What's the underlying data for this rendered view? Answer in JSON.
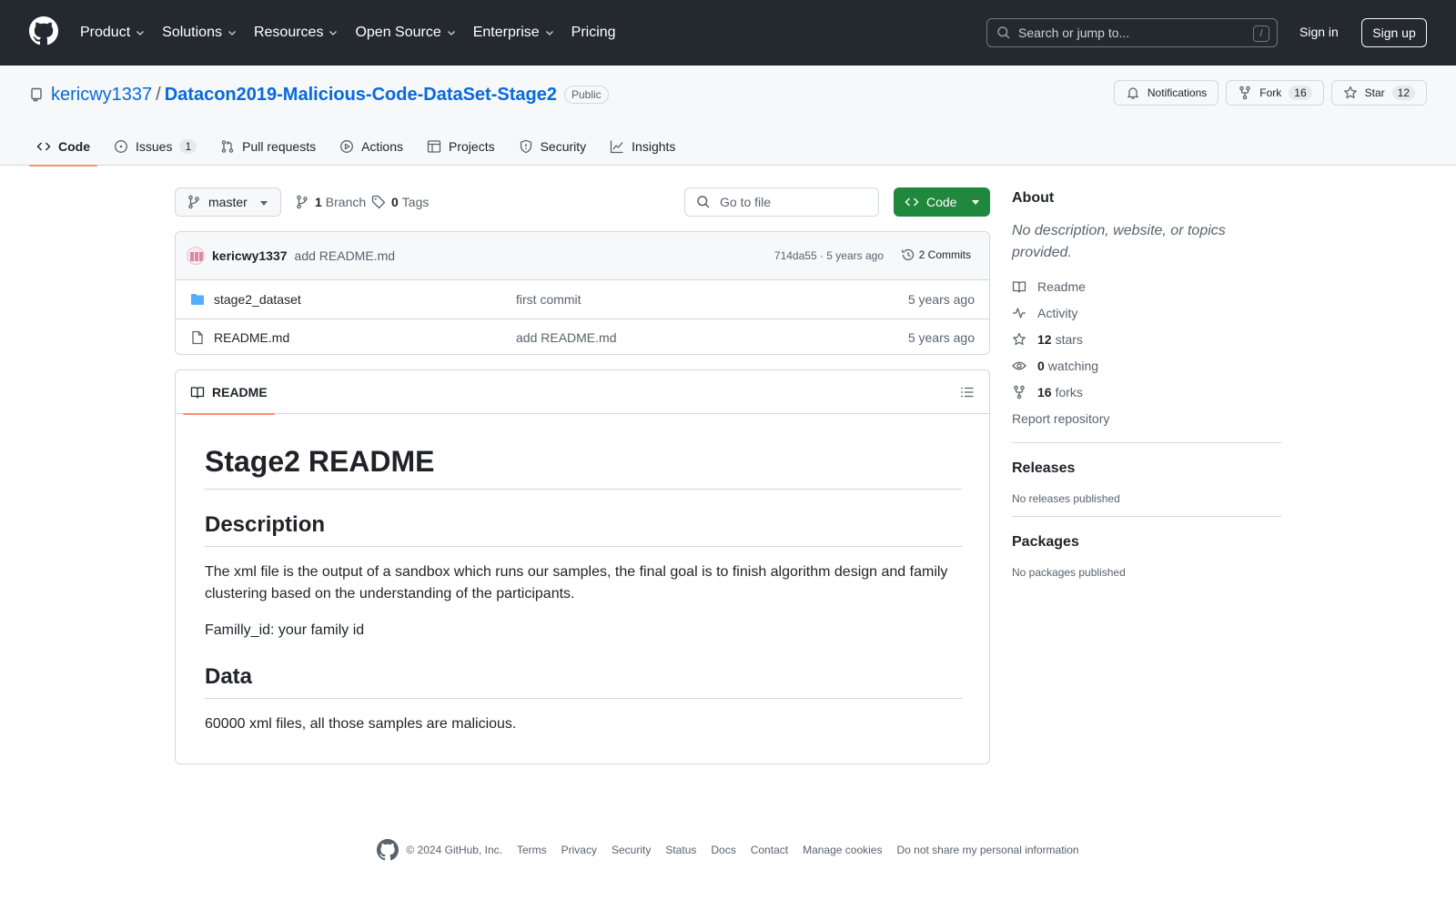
{
  "header": {
    "nav": [
      "Product",
      "Solutions",
      "Resources",
      "Open Source",
      "Enterprise",
      "Pricing"
    ],
    "search_placeholder": "Search or jump to...",
    "search_shortcut": "/",
    "sign_in": "Sign in",
    "sign_up": "Sign up"
  },
  "repo": {
    "owner": "kericwy1337",
    "separator": "/",
    "name": "Datacon2019-Malicious-Code-DataSet-Stage2",
    "visibility": "Public",
    "notifications_label": "Notifications",
    "fork_label": "Fork",
    "fork_count": "16",
    "star_label": "Star",
    "star_count": "12"
  },
  "tabs": [
    {
      "label": "Code",
      "active": true,
      "icon": "code-icon"
    },
    {
      "label": "Issues",
      "count": "1",
      "icon": "issue-icon"
    },
    {
      "label": "Pull requests",
      "icon": "pull-request-icon"
    },
    {
      "label": "Actions",
      "icon": "play-icon"
    },
    {
      "label": "Projects",
      "icon": "table-icon"
    },
    {
      "label": "Security",
      "icon": "shield-icon"
    },
    {
      "label": "Insights",
      "icon": "graph-icon"
    }
  ],
  "filebar": {
    "branch": "master",
    "branch_count": "1",
    "branch_label": "Branch",
    "tag_count": "0",
    "tag_label": "Tags",
    "goto_file": "Go to file",
    "code_button": "Code"
  },
  "commit": {
    "author": "kericwy1337",
    "message": "add README.md",
    "meta": "714da55 · 5 years ago",
    "commits": "2 Commits"
  },
  "files": [
    {
      "name": "stage2_dataset",
      "type": "folder",
      "commit": "first commit",
      "age": "5 years ago"
    },
    {
      "name": "README.md",
      "type": "file",
      "commit": "add README.md",
      "age": "5 years ago"
    }
  ],
  "readme": {
    "tab": "README",
    "h1": "Stage2 README",
    "h2_description": "Description",
    "p1": "The xml file is the output of a sandbox which runs our samples, the final goal is to finish algorithm design and family clustering based on the understanding of the participants.",
    "p2": "Familly_id: your family id",
    "h2_data": "Data",
    "p3": "60000 xml files, all those samples are malicious."
  },
  "sidebar": {
    "about_title": "About",
    "about_desc": "No description, website, or topics provided.",
    "readme_link": "Readme",
    "activity_link": "Activity",
    "stars_count": "12",
    "stars_label": "stars",
    "watching_count": "0",
    "watching_label": "watching",
    "forks_count": "16",
    "forks_label": "forks",
    "report": "Report repository",
    "releases_title": "Releases",
    "releases_empty": "No releases published",
    "packages_title": "Packages",
    "packages_empty": "No packages published"
  },
  "footer": {
    "copyright": "© 2024 GitHub, Inc.",
    "links": [
      "Terms",
      "Privacy",
      "Security",
      "Status",
      "Docs",
      "Contact",
      "Manage cookies",
      "Do not share my personal information"
    ]
  },
  "colors": {
    "header_bg": "#24292f",
    "link": "#0969da",
    "code_button": "#1f883d",
    "active_tab_underline": "#fd8c73",
    "folder": "#54aeff"
  }
}
